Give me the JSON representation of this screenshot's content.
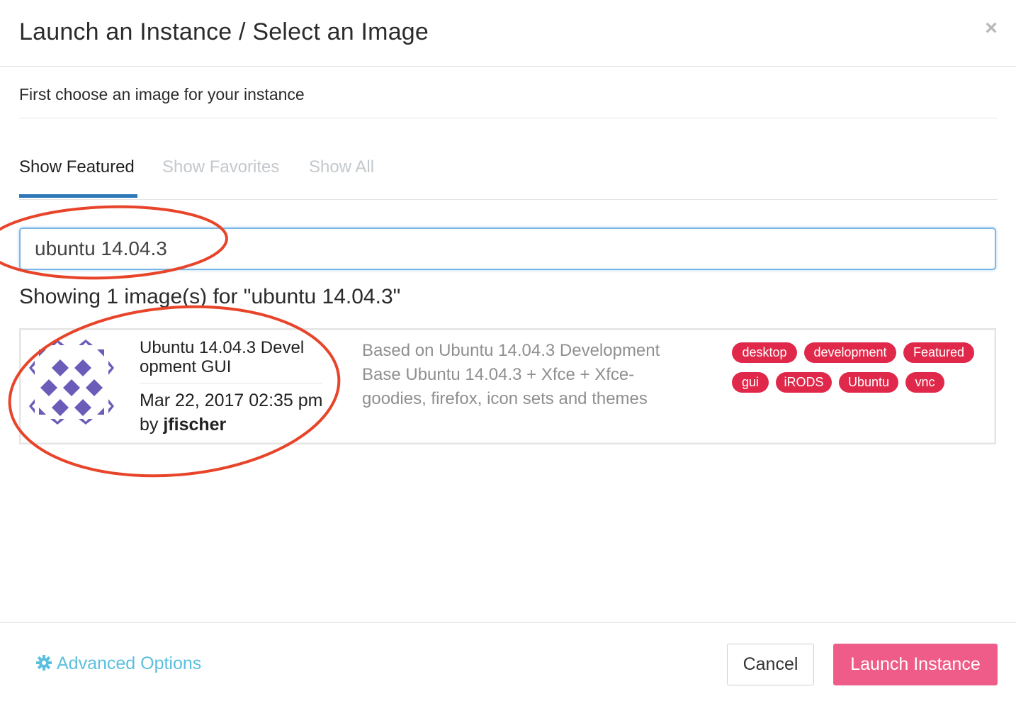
{
  "modal": {
    "title": "Launch an Instance / Select an Image",
    "close_glyph": "×",
    "subtitle": "First choose an image for your instance"
  },
  "tabs": [
    {
      "label": "Show Featured",
      "active": true
    },
    {
      "label": "Show Favorites",
      "active": false
    },
    {
      "label": "Show All",
      "active": false
    }
  ],
  "search": {
    "value": "ubuntu 14.04.3",
    "results_text": "Showing 1 image(s) for \"ubuntu 14.04.3\""
  },
  "results": [
    {
      "icon": "identicon-purple",
      "name": "Ubuntu 14.04.3 Devel opment GUI",
      "date": "Mar 22, 2017 02:35 pm",
      "author_prefix": "by",
      "author": "jfischer",
      "description": "Based on Ubuntu 14.04.3 Development Base Ubuntu 14.04.3 + Xfce + Xfce-goodies, firefox, icon sets and themes",
      "tags": [
        "desktop",
        "development",
        "Featured",
        "gui",
        "iRODS",
        "Ubuntu",
        "vnc"
      ]
    }
  ],
  "footer": {
    "advanced_label": "Advanced Options",
    "advanced_icon": "gear-icon",
    "cancel_label": "Cancel",
    "launch_label": "Launch Instance"
  },
  "colors": {
    "tab_active_underline": "#2e78b8",
    "tag_bg": "#e0294a",
    "launch_bg": "#ef5c89",
    "link": "#5bc0de",
    "annotation": "#e8442a",
    "identicon": "#6a5cb8"
  }
}
